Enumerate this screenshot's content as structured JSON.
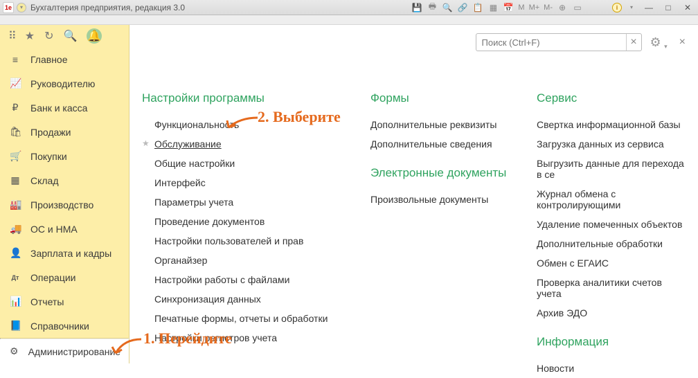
{
  "titlebar": {
    "app_title": "Бухгалтерия предприятия, редакция 3.0",
    "logo_text": "1e",
    "m_buttons": [
      "M",
      "M+",
      "M-"
    ]
  },
  "search": {
    "placeholder": "Поиск (Ctrl+F)"
  },
  "sidebar": {
    "items": [
      {
        "icon": "≡",
        "label": "Главное"
      },
      {
        "icon": "📈",
        "label": "Руководителю"
      },
      {
        "icon": "₽",
        "label": "Банк и касса"
      },
      {
        "icon": "🛍",
        "label": "Продажи"
      },
      {
        "icon": "🛒",
        "label": "Покупки"
      },
      {
        "icon": "▦",
        "label": "Склад"
      },
      {
        "icon": "🏭",
        "label": "Производство"
      },
      {
        "icon": "🚚",
        "label": "ОС и НМА"
      },
      {
        "icon": "👤",
        "label": "Зарплата и кадры"
      },
      {
        "icon": "Дт",
        "label": "Операции"
      },
      {
        "icon": "📊",
        "label": "Отчеты"
      },
      {
        "icon": "📘",
        "label": "Справочники"
      },
      {
        "icon": "⚙",
        "label": "Администрирование"
      }
    ]
  },
  "sections": {
    "settings": {
      "title": "Настройки программы",
      "links": [
        "Функциональность",
        "Обслуживание",
        "Общие настройки",
        "Интерфейс",
        "Параметры учета",
        "Проведение документов",
        "Настройки пользователей и прав",
        "Органайзер",
        "Настройки работы с файлами",
        "Синхронизация данных",
        "Печатные формы, отчеты и обработки",
        "Настройки регистров учета"
      ]
    },
    "forms": {
      "title": "Формы",
      "links": [
        "Дополнительные реквизиты",
        "Дополнительные сведения"
      ]
    },
    "edoc": {
      "title": "Электронные документы",
      "links": [
        "Произвольные документы"
      ]
    },
    "service": {
      "title": "Сервис",
      "links": [
        "Свертка информационной базы",
        "Загрузка данных из сервиса",
        "Выгрузить данные для перехода в се",
        "Журнал обмена с контролирующими",
        "Удаление помеченных объектов",
        "Дополнительные обработки",
        "Обмен с ЕГАИС",
        "Проверка аналитики счетов учета",
        "Архив ЭДО"
      ]
    },
    "info": {
      "title": "Информация",
      "links": [
        "Новости"
      ]
    }
  },
  "annotations": {
    "step1": "1. Перейдите",
    "step2": "2. Выберите"
  }
}
